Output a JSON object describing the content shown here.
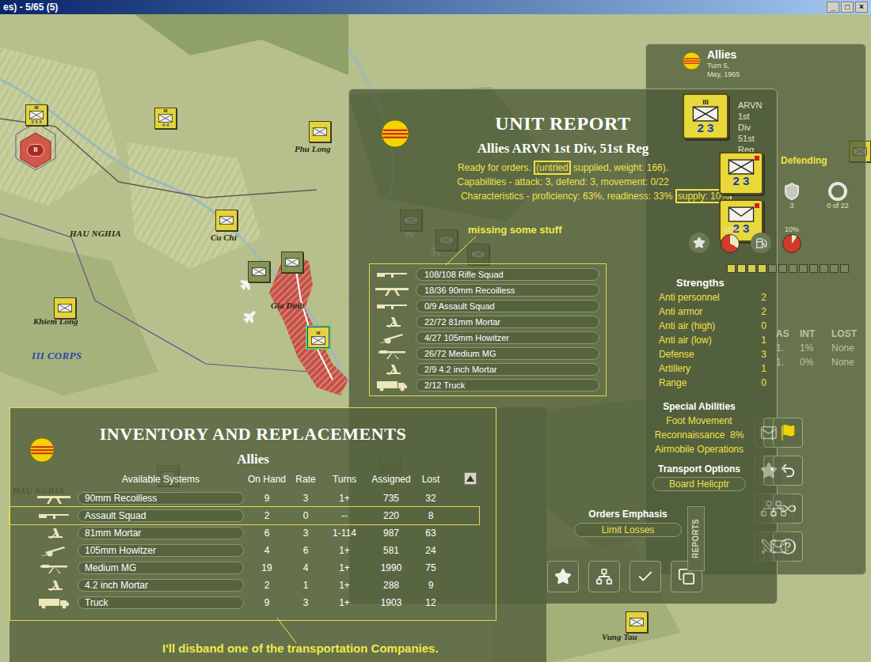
{
  "window": {
    "title": "es) - 5/65 (5)",
    "controls": [
      "_",
      "□",
      "×"
    ]
  },
  "map": {
    "labels": [
      {
        "text": "Phu Long",
        "kind": "town"
      },
      {
        "text": "HAU NGHIA",
        "kind": "province"
      },
      {
        "text": "Cu Chi",
        "kind": "town"
      },
      {
        "text": "Gia Dinh",
        "kind": "town"
      },
      {
        "text": "Khiem Long",
        "kind": "town"
      },
      {
        "text": "III CORPS",
        "kind": "corps"
      },
      {
        "text": "HAU NGHIA",
        "kind": "province"
      },
      {
        "text": "IA DINH",
        "kind": "province"
      },
      {
        "text": "Vung Tau",
        "kind": "town"
      }
    ],
    "objective": {
      "text": "II"
    },
    "counters": [
      {
        "color": "#e3d43c",
        "size": "III",
        "values": "3 5 3",
        "selected": false
      },
      {
        "color": "#e3d43c",
        "size": "III",
        "values": "4 4",
        "selected": false
      },
      {
        "color": "#e3d43c",
        "size": "",
        "values": "",
        "selected": false
      },
      {
        "color": "#e3d43c",
        "size": "",
        "values": "",
        "selected": false
      },
      {
        "color": "#7f9656",
        "size": "",
        "values": "",
        "selected": false
      },
      {
        "color": "#7f9656",
        "size": "",
        "values": "",
        "selected": false
      },
      {
        "color": "#e3d43c",
        "size": "",
        "values": "",
        "selected": false
      },
      {
        "color": "#e3d43c",
        "size": "III",
        "values": "",
        "selected": true
      },
      {
        "color": "#7f9656",
        "size": "",
        "values": "",
        "selected": false
      },
      {
        "color": "#7f9656",
        "size": "",
        "values": "",
        "selected": false
      },
      {
        "color": "#7f9656",
        "size": "",
        "values": "",
        "selected": false
      },
      {
        "color": "#7f9656",
        "size": "",
        "values": "",
        "selected": false
      },
      {
        "color": "#7f9656",
        "size": "",
        "values": "",
        "selected": false
      },
      {
        "color": "#e3d43c",
        "size": "",
        "values": "",
        "selected": false
      },
      {
        "color": "#e3d43c",
        "size": "",
        "values": "",
        "selected": false
      }
    ]
  },
  "unit_report": {
    "title": "UNIT REPORT",
    "subtitle": "Allies ARVN 1st Div, 51st Reg",
    "status_line": [
      {
        "text": "Ready for orders. ",
        "highlighted": false
      },
      {
        "text": "(untried",
        "highlighted": true
      },
      {
        "text": " supplied, weight: 166).",
        "highlighted": false
      }
    ],
    "capabilities": "Capabilities - attack: 3, defend: 3, movement: 0/22",
    "characteristics": [
      {
        "text": "Characteristics - proficiency: 63%, readiness: 33% ",
        "highlighted": false
      },
      {
        "text": "supply: 10%",
        "highlighted": true
      }
    ],
    "annotation": "missing some stuff",
    "equipment": [
      {
        "text": "108/108 Rifle Squad",
        "kind": "rifle"
      },
      {
        "text": "18/36 90mm Recoilless",
        "kind": "recoilless"
      },
      {
        "text": "0/9 Assault Squad",
        "kind": "rifle"
      },
      {
        "text": "22/72 81mm Mortar",
        "kind": "mortar"
      },
      {
        "text": "4/27 105mm Howitzer",
        "kind": "howitzer"
      },
      {
        "text": "26/72 Medium MG",
        "kind": "mg"
      },
      {
        "text": "2/9 4.2 inch Mortar",
        "kind": "mortar"
      },
      {
        "text": "2/12 Truck",
        "kind": "truck"
      }
    ],
    "buttons": [
      {
        "kind": "star"
      },
      {
        "kind": "org"
      },
      {
        "kind": "check"
      },
      {
        "kind": "copy"
      }
    ]
  },
  "side_panel": {
    "title": "Allies",
    "turn": "Turn 5, May, 1965",
    "unit_name": "ARVN 1st Div",
    "unit_sub": "51st Reg",
    "posture": "Defending",
    "stack": [
      {
        "size": "III",
        "values": "2 3",
        "kind": "infantry"
      },
      {
        "size": "",
        "values": "2 3",
        "kind": "infantry"
      },
      {
        "size": "",
        "values": "2 3",
        "kind": "hq"
      }
    ],
    "stats": [
      {
        "kind": "shield",
        "text": "3"
      },
      {
        "kind": "ring",
        "text": "0 of 22"
      }
    ],
    "meters": [
      {
        "text": "33%",
        "level": 0.33
      },
      {
        "text": "10%",
        "level": 0.1
      }
    ],
    "readiness_bar": {
      "level": 0.33
    },
    "strengths": {
      "title": "Strengths",
      "rows": [
        {
          "label": "Anti personnel",
          "value": "2"
        },
        {
          "label": "Anti armor",
          "value": "2"
        },
        {
          "label": "Anti air (high)",
          "value": "0"
        },
        {
          "label": "Anti air (low)",
          "value": "1"
        },
        {
          "label": "Defense",
          "value": "3"
        },
        {
          "label": "Artillery",
          "value": "1"
        },
        {
          "label": "Range",
          "value": "0"
        }
      ]
    },
    "combat_table": {
      "columns": [
        "AS",
        "INT",
        "LOST"
      ],
      "rows": [
        [
          "1.",
          "1%",
          "None"
        ],
        [
          "1.",
          "0%",
          "None"
        ]
      ]
    },
    "special": {
      "title": "Special Abilities",
      "items": [
        "Foot Movement",
        "Reconnaissance  8%",
        "Airmobile Operations"
      ]
    },
    "transport": {
      "title": "Transport Options",
      "value": "Board Helicptr"
    },
    "orders": {
      "title": "Orders Emphasis",
      "value": "Limit Losses"
    },
    "reports_tab": "REPORTS",
    "buttons": [
      {
        "kind": "mail",
        "disabled": true
      },
      {
        "kind": "clipboard-x",
        "disabled": false
      },
      {
        "kind": "flag",
        "disabled": false
      },
      {
        "kind": "star",
        "disabled": true
      },
      {
        "kind": "star",
        "disabled": false
      },
      {
        "kind": "undo",
        "disabled": false
      },
      {
        "kind": "network",
        "disabled": true
      },
      {
        "kind": "network",
        "disabled": true
      },
      {
        "kind": "infinity",
        "disabled": false
      },
      {
        "kind": "swords",
        "disabled": true
      },
      {
        "kind": "mail",
        "disabled": true
      },
      {
        "kind": "help",
        "disabled": false
      }
    ]
  },
  "inventory": {
    "title": "INVENTORY AND REPLACEMENTS",
    "side": "Allies",
    "columns": [
      "Available Systems",
      "On Hand",
      "Rate",
      "Turns",
      "Assigned",
      "Lost"
    ],
    "rows": [
      {
        "name": "90mm Recoilless",
        "on_hand": "9",
        "rate": "3",
        "turns": "1+",
        "assigned": "735",
        "lost": "32",
        "kind": "recoilless",
        "highlighted": false
      },
      {
        "name": "Assault Squad",
        "on_hand": "2",
        "rate": "0",
        "turns": "--",
        "assigned": "220",
        "lost": "8",
        "kind": "rifle",
        "highlighted": true
      },
      {
        "name": "81mm Mortar",
        "on_hand": "6",
        "rate": "3",
        "turns": "1-114",
        "assigned": "987",
        "lost": "63",
        "kind": "mortar",
        "highlighted": false
      },
      {
        "name": "105mm Howitzer",
        "on_hand": "4",
        "rate": "6",
        "turns": "1+",
        "assigned": "581",
        "lost": "24",
        "kind": "howitzer",
        "highlighted": false
      },
      {
        "name": "Medium MG",
        "on_hand": "19",
        "rate": "4",
        "turns": "1+",
        "assigned": "1990",
        "lost": "75",
        "kind": "mg",
        "highlighted": false
      },
      {
        "name": "4.2 inch Mortar",
        "on_hand": "2",
        "rate": "1",
        "turns": "1+",
        "assigned": "288",
        "lost": "9",
        "kind": "mortar",
        "highlighted": false
      },
      {
        "name": "Truck",
        "on_hand": "9",
        "rate": "3",
        "turns": "1+",
        "assigned": "1903",
        "lost": "12",
        "kind": "truck",
        "highlighted": false
      }
    ],
    "annotation": "I'll disband one of the transportation Companies."
  }
}
